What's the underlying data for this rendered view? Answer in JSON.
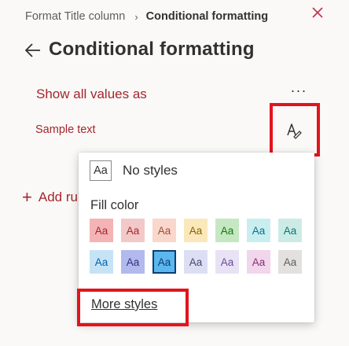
{
  "header": {
    "breadcrumb_parent": "Format Title column",
    "breadcrumb_separator": "›",
    "breadcrumb_current": "Conditional formatting",
    "title": "Conditional formatting"
  },
  "rule": {
    "show_values_label": "Show all values as",
    "more_label": "···",
    "sample_text": "Sample text"
  },
  "add_rule": {
    "plus": "+",
    "label": "Add ru"
  },
  "popup": {
    "aa_icon_text": "Aa",
    "no_styles_label": "No styles",
    "fill_color_label": "Fill color",
    "swatch_text": "Aa",
    "more_styles_label": "More styles",
    "swatches": [
      {
        "bg": "#f4b3b5",
        "fg": "#a4262c"
      },
      {
        "bg": "#f3c8c9",
        "fg": "#a4262c"
      },
      {
        "bg": "#f9d7cc",
        "fg": "#a0512c"
      },
      {
        "bg": "#fbe8ba",
        "fg": "#8a6100"
      },
      {
        "bg": "#c5e7c2",
        "fg": "#107c10"
      },
      {
        "bg": "#c9eef0",
        "fg": "#00758f"
      },
      {
        "bg": "#cdebe6",
        "fg": "#007a73"
      },
      {
        "bg": "#c6e3f6",
        "fg": "#0063a8"
      },
      {
        "bg": "#b2b9ed",
        "fg": "#323180"
      },
      {
        "bg": "#5cb6f0",
        "fg": "#0b3f6e",
        "selected": true
      },
      {
        "bg": "#dcdff4",
        "fg": "#43476f"
      },
      {
        "bg": "#e8e2f4",
        "fg": "#6a4c93"
      },
      {
        "bg": "#f1d6ec",
        "fg": "#8a2c77"
      },
      {
        "bg": "#e2e1e0",
        "fg": "#605e5c"
      }
    ]
  },
  "colors": {
    "accent": "#a4262c",
    "highlight": "#e3141c",
    "close": "#c4314b"
  }
}
